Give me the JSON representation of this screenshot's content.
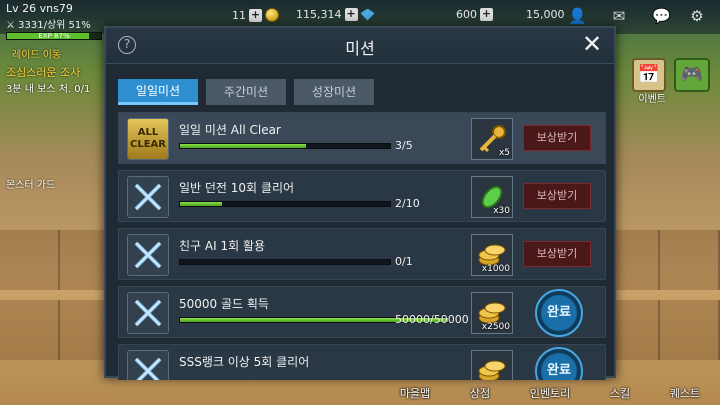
{
  "hud": {
    "level": "Lv 26",
    "username": "vns79",
    "power": "3331/상위 51%",
    "exp_label": "EXP 87%",
    "exp_fill": 0.87,
    "quest_tag": "레이드 이동",
    "quest_title": "조심스러운 조사",
    "quest_desc": "3분 내 보스 처. 0/1",
    "monster_guard": "몬스터 가드",
    "resource1": "11",
    "gold": "115,314",
    "resource3": "600",
    "resource4": "15,000"
  },
  "side": {
    "event_label": "이벤트"
  },
  "bottom_nav": [
    "마을맵",
    "상점",
    "인벤토리",
    "스킬",
    "퀘스트"
  ],
  "modal": {
    "title": "미션",
    "help_glyph": "?",
    "close_glyph": "✕",
    "tabs": [
      "일일미션",
      "주간미션",
      "성장미션"
    ],
    "active_tab": 0
  },
  "missions": [
    {
      "name": "일일 미션 All Clear",
      "count": "3/5",
      "progress": 0.6,
      "icon": "all-clear-icon",
      "icon_text": "ALL CLEAR",
      "reward_icon": "golden-key-icon",
      "reward_qty": "x5",
      "action": "보상받기",
      "status": "claim"
    },
    {
      "name": "일반 던전 10회 클리어",
      "count": "2/10",
      "progress": 0.2,
      "icon": "crossed-swords-icon",
      "reward_icon": "green-potion-icon",
      "reward_qty": "x30",
      "action": "보상받기",
      "status": "claim"
    },
    {
      "name": "친구 AI 1회 활용",
      "count": "0/1",
      "progress": 0.0,
      "icon": "crossed-swords-icon",
      "reward_icon": "gold-coins-icon",
      "reward_qty": "x1000",
      "action": "보상받기",
      "status": "claim"
    },
    {
      "name": "50000 골드 획득",
      "count": "50000/50000",
      "progress": 1.0,
      "icon": "crossed-swords-icon",
      "reward_icon": "gold-coins-icon",
      "reward_qty": "x2500",
      "action": "완료",
      "status": "done"
    },
    {
      "name": "SSS랭크 이상 5회 클리어",
      "count": "",
      "progress": 0.0,
      "icon": "crossed-swords-icon",
      "reward_icon": "gold-coins-icon",
      "reward_qty": "",
      "action": "완료",
      "status": "done"
    }
  ],
  "colors": {
    "accent_tab": "#2e8fd0",
    "progress_green": "#6ccf34",
    "claim_bg": "#4a1818"
  }
}
